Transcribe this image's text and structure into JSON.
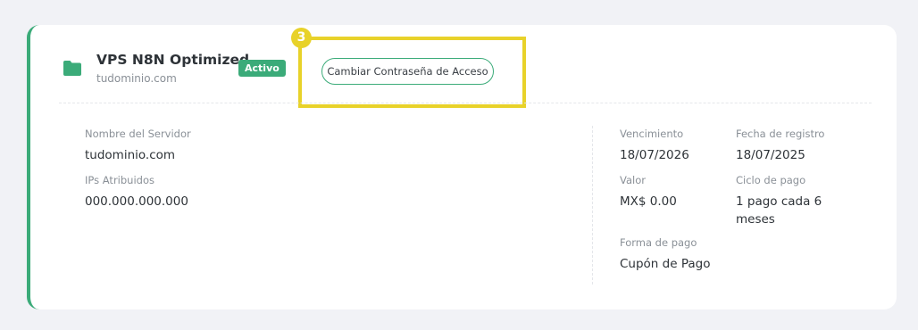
{
  "service": {
    "title": "VPS N8N Optimized",
    "domain": "tudominio.com",
    "status": "Activo"
  },
  "actions": {
    "change_password_label": "Cambiar Contraseña de Acceso"
  },
  "annotation": {
    "step_number": "3"
  },
  "details": {
    "server_name_label": "Nombre del Servidor",
    "server_name_value": "tudominio.com",
    "ips_label": "IPs Atribuidos",
    "ips_value": "000.000.000.000",
    "due_label": "Vencimiento",
    "due_value": "18/07/2026",
    "registered_label": "Fecha de registro",
    "registered_value": "18/07/2025",
    "amount_label": "Valor",
    "amount_value": "MX$ 0.00",
    "cycle_label": "Ciclo de pago",
    "cycle_value": "1 pago cada 6 meses",
    "payment_method_label": "Forma de pago",
    "payment_method_value": "Cupón de Pago"
  },
  "colors": {
    "accent": "#3bab79",
    "highlight": "#e8d22a",
    "background": "#f1f2f6"
  },
  "icons": {
    "service": "folder-icon"
  }
}
